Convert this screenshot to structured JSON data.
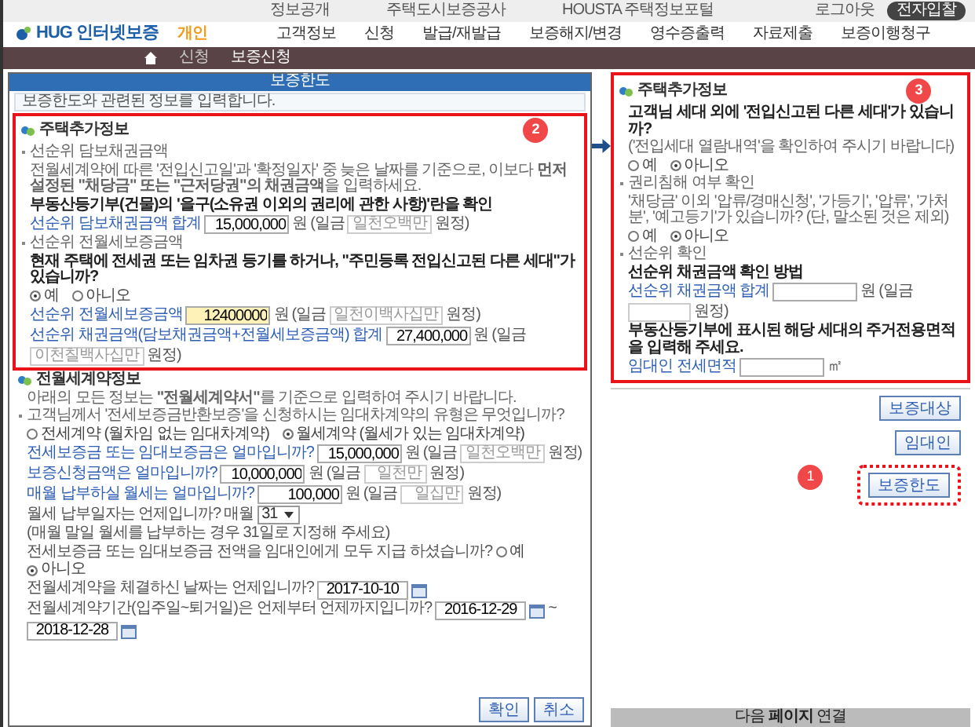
{
  "top_bar": {
    "links": [
      "정보공개",
      "주택도시보증공사",
      "HOUSTA 주택정보포털"
    ],
    "logout": "로그아웃",
    "button": "전자입찰"
  },
  "header": {
    "logo": "HUG 인터넷보증",
    "tag": "개인",
    "menu": [
      "고객정보",
      "신청",
      "발급/재발급",
      "보증해지/변경",
      "영수증출력",
      "자료제출",
      "보증이행청구"
    ]
  },
  "breadcrumb": [
    "신청",
    "보증신청"
  ],
  "dialog": {
    "title": "보증한도",
    "notice": "보증한도와 관련된 정보를 입력합니다.",
    "badge": "2",
    "housing": {
      "heading": "주택추가정보",
      "blocks": [
        {
          "kind": "label",
          "text": "선순위 담보채권금액"
        },
        {
          "kind": "text",
          "text": "전월세계약에 따른 '전입신고일'과 '확정일자' 중 늦은 날짜를 기준으로, 이보다 **먼저 설정된 \"채당금\" 또는 \"근저당권\"의 채권금액**을 입력하세요."
        },
        {
          "kind": "strong",
          "text": "부동산등기부(건물)의 '을구(소유권 이외의 권리에 관한 사항)'란을 확인"
        },
        {
          "kind": "field",
          "label": "선순위 담보채권금액 합계",
          "value": "15,000,000",
          "unit": "원",
          "words_prefix": "(일금",
          "words": "일천오백만",
          "words_suffix": "원정)",
          "highlighted": false
        },
        {
          "kind": "label",
          "text": "선순위 전월세보증금액"
        },
        {
          "kind": "strong",
          "text": "현재 주택에 전세권 또는 임차권 등기를 하거나, \"주민등록 전입신고된 다른 세대\"가 있습니까?"
        },
        {
          "kind": "radio",
          "options": [
            {
              "label": "예",
              "selected": true
            },
            {
              "label": "아니오",
              "selected": false
            }
          ]
        },
        {
          "kind": "field",
          "label": "선순위 전월세보증금액",
          "value": "12400000",
          "unit": "원",
          "words_prefix": "(일금",
          "words": "일천이백사십만",
          "words_suffix": "원정)",
          "highlighted": true
        },
        {
          "kind": "field",
          "label": "선순위 채권금액(담보채권금액+전월세보증금액) 합계",
          "value": "27,400,000",
          "unit": "원",
          "words_prefix": "(일금",
          "words": "이천칠백사십만",
          "words_suffix": "원정)",
          "highlighted": false
        }
      ]
    },
    "contract": {
      "heading": "전월세계약정보",
      "blocks": [
        {
          "kind": "text",
          "text": "아래의 모든 정보는 **\"전월세계약서\"**를 기준으로 입력하여 주시기 바랍니다."
        },
        {
          "kind": "label",
          "text": "고객님께서 '전세보증금반환보증'을 신청하시는 임대차계약의 유형은 무엇입니까?"
        },
        {
          "kind": "radio",
          "options": [
            {
              "label": "전세계약 (월차임 없는 임대차계약)",
              "selected": false
            },
            {
              "label": "월세계약 (월세가 있는 임대차계약)",
              "selected": true
            }
          ]
        },
        {
          "kind": "field",
          "label": "전세보증금 또는 임대보증금은 얼마입니까?",
          "value": "15,000,000",
          "unit": "원",
          "words_prefix": "(일금",
          "words": "일천오백만",
          "words_suffix": "원정)",
          "highlighted": false
        },
        {
          "kind": "field",
          "label": "보증신청금액은 얼마입니까?",
          "value": "10,000,000",
          "unit": "원",
          "words_prefix": "(일금",
          "words": "일천만",
          "words_suffix": "원정)",
          "highlighted": false
        },
        {
          "kind": "field",
          "label": "매월 납부하실 월세는 얼마입니까?",
          "value": "100,000",
          "unit": "원",
          "words_prefix": "(일금",
          "words": "일십만",
          "words_suffix": "원정)",
          "highlighted": false
        },
        {
          "kind": "select",
          "label": "월세 납부일자는 언제입니까?",
          "prefix": "매월",
          "value": "31",
          "note": "(매월 말일 월세를 납부하는 경우 31일로 지정해 주세요)"
        },
        {
          "kind": "question",
          "label": "전세보증금 또는 임대보증금 전액을 임대인에게 모두 지급 하셨습니까?",
          "options": [
            {
              "label": "예",
              "selected": false
            },
            {
              "label": "아니오",
              "selected": true
            }
          ]
        },
        {
          "kind": "dates",
          "label": "전월세계약을 체결하신 날짜는 언제입니까?",
          "dates": [
            "2017-10-10"
          ]
        },
        {
          "kind": "dates",
          "label": "전월세계약기간(입주일~퇴거일)은 언제부터 언제까지입니까?",
          "dates": [
            "2016-12-29",
            "2018-12-28"
          ],
          "separator": "~"
        }
      ]
    },
    "buttons": [
      "확인",
      "취소"
    ]
  },
  "side_panel": {
    "badge": "3",
    "heading": "주택추가정보",
    "blocks": [
      {
        "kind": "strong",
        "text": "고객님 세대 외에 '전입신고된 다른 세대'가 있습니까?"
      },
      {
        "kind": "text",
        "text": "('전입세대 열람내역'을 확인하여 주시기 바랍니다)"
      },
      {
        "kind": "radio",
        "options": [
          {
            "label": "예",
            "selected": false
          },
          {
            "label": "아니오",
            "selected": true
          }
        ]
      },
      {
        "kind": "label",
        "text": "권리침해 여부 확인"
      },
      {
        "kind": "text",
        "text": "'채당금' 이외 '압류/경매신청', '가등기', '압류', '가처분', '예고등기'가 있습니까? (단, 말소된 것은 제외)"
      },
      {
        "kind": "radio",
        "options": [
          {
            "label": "예",
            "selected": false
          },
          {
            "label": "아니오",
            "selected": true
          }
        ]
      },
      {
        "kind": "label",
        "text": "선순위 확인"
      },
      {
        "kind": "strong",
        "text": "선순위 채권금액 확인 방법"
      },
      {
        "kind": "field",
        "label": "선순위 채권금액 합계",
        "unit": "원",
        "words_prefix": "(일금",
        "words_suffix": "원정)",
        "highlighted": false
      },
      {
        "kind": "strong",
        "text": "부동산등기부에 표시된 해당 세대의 주거전용면적을 입력해 주세요."
      },
      {
        "kind": "field",
        "label": "임대인 전세면적",
        "unit": "㎡",
        "highlighted": false
      }
    ]
  },
  "page": {
    "buttons": [
      "보증대상",
      "임대인"
    ],
    "target_button": "보증한도",
    "badge": "1",
    "footer": "다음 **페이지** 연결"
  }
}
